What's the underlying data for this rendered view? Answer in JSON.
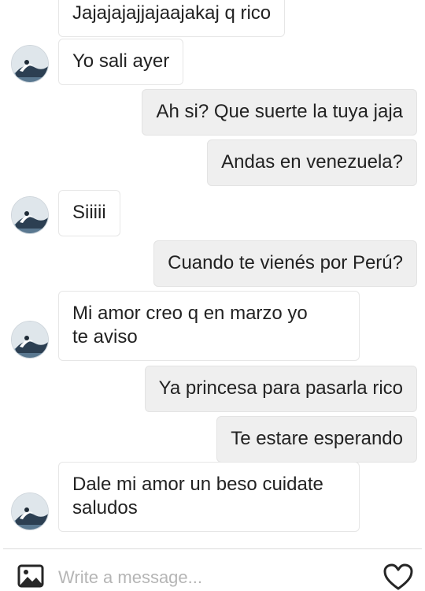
{
  "messages": [
    {
      "id": "m1",
      "side": "incoming",
      "text": "Jajajajajjajaajakaj q rico"
    },
    {
      "id": "m2",
      "side": "incoming",
      "text": "Yo sali ayer"
    },
    {
      "id": "m3",
      "side": "outgoing",
      "text": "Ah si? Que suerte la tuya jaja"
    },
    {
      "id": "m4",
      "side": "outgoing",
      "text": "Andas en venezuela?"
    },
    {
      "id": "m5",
      "side": "incoming",
      "text": "Siiiii"
    },
    {
      "id": "m6",
      "side": "outgoing",
      "text": "Cuando te vienés por Perú?"
    },
    {
      "id": "m7",
      "side": "incoming",
      "lines": [
        "Mi amor creo q en marzo yo",
        "te aviso"
      ]
    },
    {
      "id": "m8",
      "side": "outgoing",
      "text": "Ya princesa para pasarla rico"
    },
    {
      "id": "m9",
      "side": "outgoing",
      "text": "Te estare esperando"
    },
    {
      "id": "m10",
      "side": "incoming",
      "lines": [
        "Dale mi amor un beso cuidate",
        "saludos"
      ]
    }
  ],
  "composer": {
    "placeholder": "Write a message...",
    "value": ""
  },
  "icons": {
    "avatar": "contact-avatar",
    "attach": "image-icon",
    "like": "heart-icon"
  },
  "colors": {
    "incoming_bubble": "#ffffff",
    "outgoing_bubble": "#efefef",
    "text": "#222222",
    "placeholder": "#b5b5b5"
  }
}
